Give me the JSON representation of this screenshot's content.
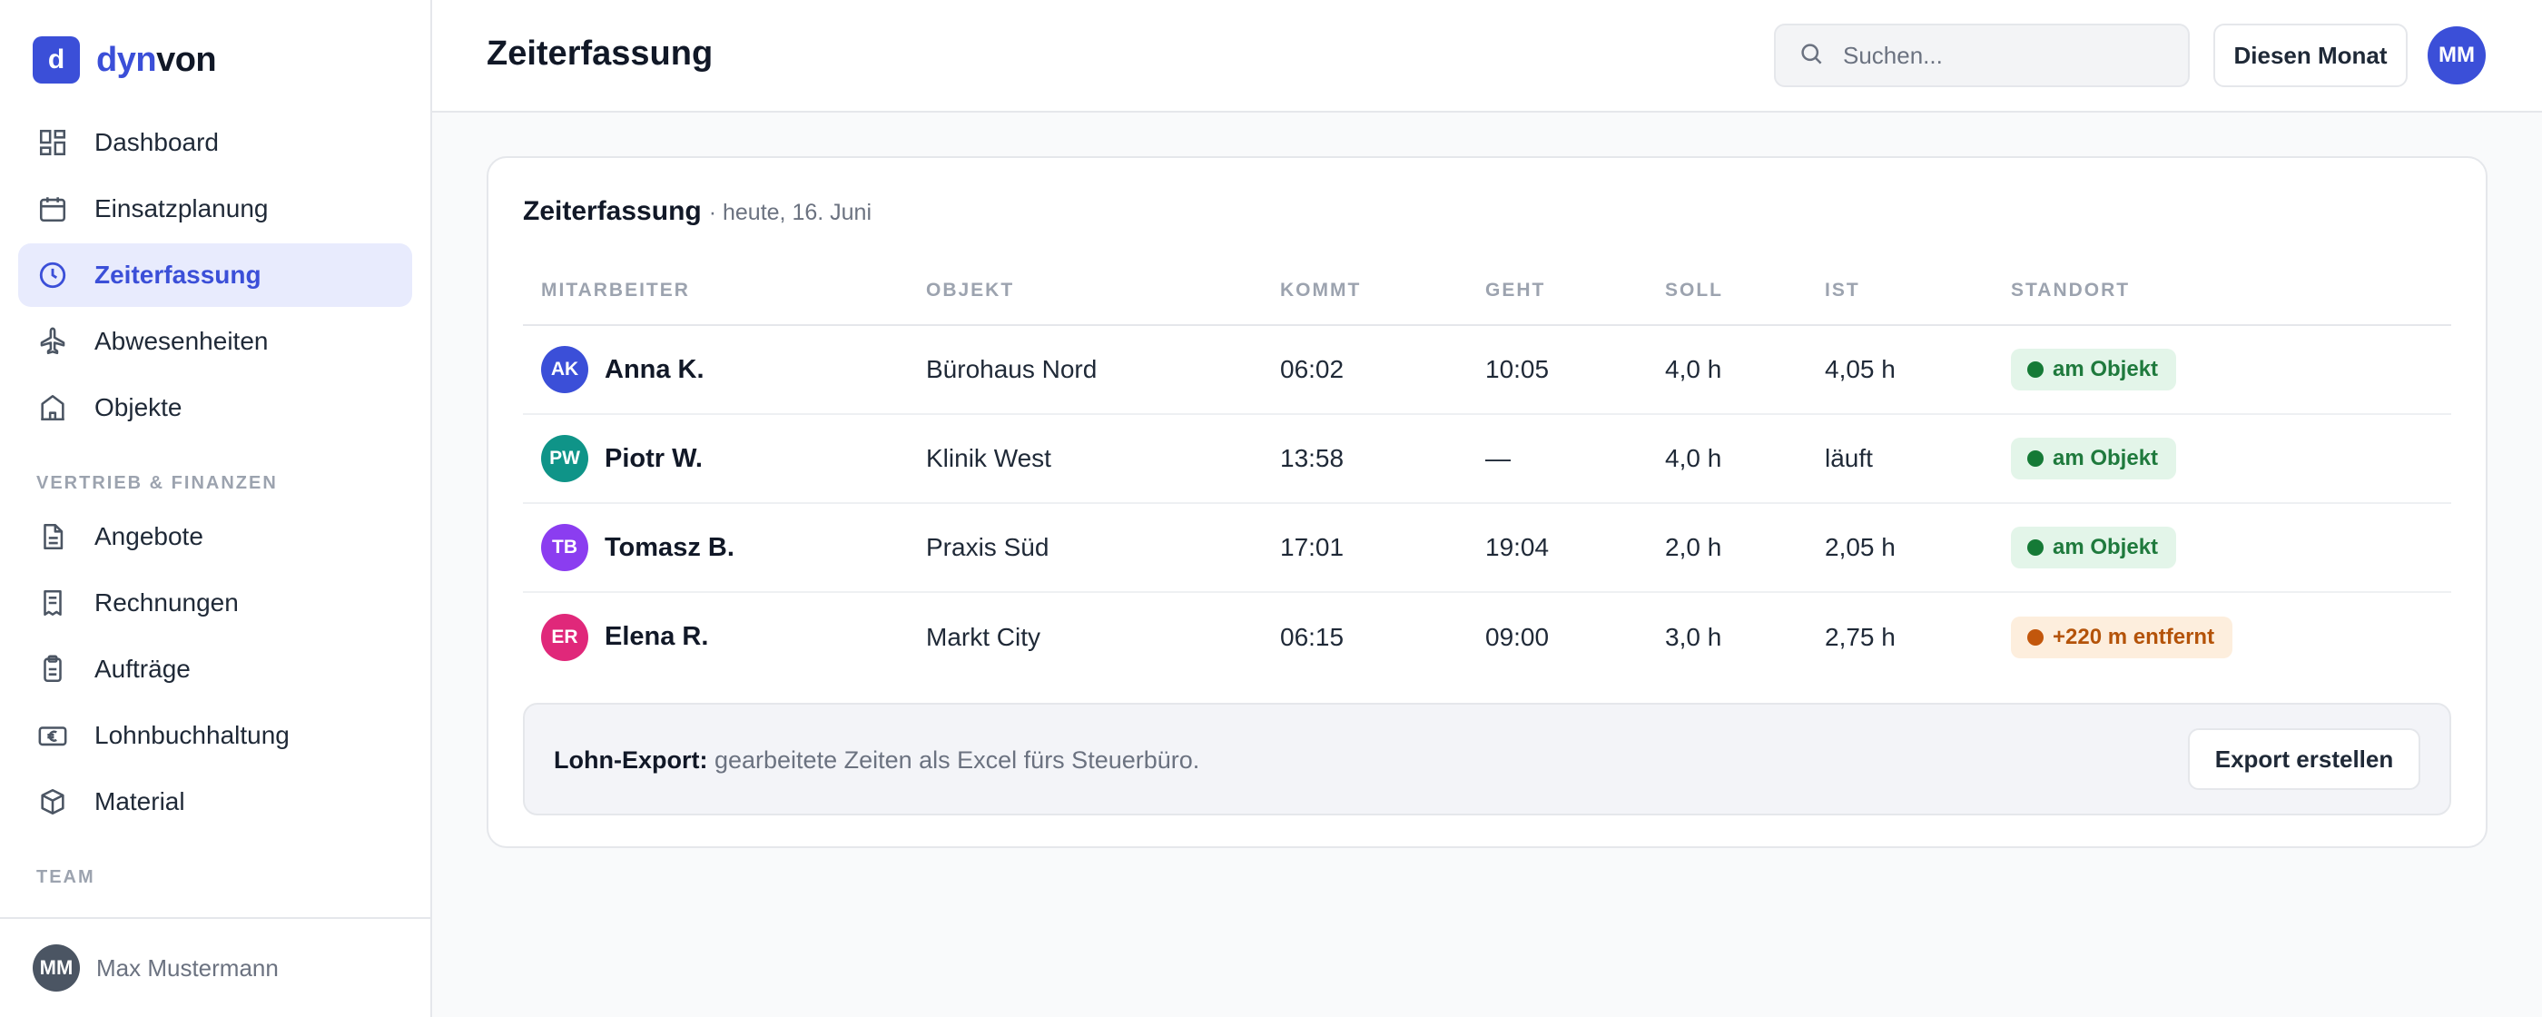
{
  "brand": {
    "mark": "d",
    "name_accent": "dyn",
    "name_rest": "von",
    "color": "#3b4fd8"
  },
  "sidebar": {
    "items": [
      {
        "label": "Dashboard",
        "icon": "dashboard-icon"
      },
      {
        "label": "Einsatzplanung",
        "icon": "calendar-icon"
      },
      {
        "label": "Zeiterfassung",
        "icon": "clock-icon",
        "active": true
      },
      {
        "label": "Abwesenheiten",
        "icon": "plane-icon"
      },
      {
        "label": "Objekte",
        "icon": "building-icon"
      }
    ],
    "section_sales": "VERTRIEB & FINANZEN",
    "sales_items": [
      {
        "label": "Angebote",
        "icon": "document-icon"
      },
      {
        "label": "Rechnungen",
        "icon": "receipt-icon"
      },
      {
        "label": "Aufträge",
        "icon": "clipboard-icon"
      },
      {
        "label": "Lohnbuchhaltung",
        "icon": "euro-icon"
      },
      {
        "label": "Material",
        "icon": "box-icon"
      }
    ],
    "section_team": "TEAM",
    "user": {
      "initials": "MM",
      "name": "Max Mustermann"
    }
  },
  "header": {
    "title": "Zeiterfassung",
    "search_placeholder": "Suchen...",
    "period_button": "Diesen Monat",
    "avatar_initials": "MM"
  },
  "card": {
    "title": "Zeiterfassung",
    "subtitle": "· heute, 16. Juni",
    "columns": [
      "MITARBEITER",
      "OBJEKT",
      "KOMMT",
      "GEHT",
      "SOLL",
      "IST",
      "STANDORT"
    ],
    "rows": [
      {
        "initials": "AK",
        "avatar_color": "#3b4fd8",
        "name": "Anna K.",
        "object": "Bürohaus Nord",
        "in": "06:02",
        "out": "10:05",
        "target": "4,0 h",
        "actual": "4,05 h",
        "location": "am Objekt",
        "status": "ok"
      },
      {
        "initials": "PW",
        "avatar_color": "#0f9488",
        "name": "Piotr W.",
        "object": "Klinik West",
        "in": "13:58",
        "out": "—",
        "target": "4,0 h",
        "actual": "läuft",
        "location": "am Objekt",
        "status": "ok"
      },
      {
        "initials": "TB",
        "avatar_color": "#8b3df0",
        "name": "Tomasz B.",
        "object": "Praxis Süd",
        "in": "17:01",
        "out": "19:04",
        "target": "2,0 h",
        "actual": "2,05 h",
        "location": "am Objekt",
        "status": "ok"
      },
      {
        "initials": "ER",
        "avatar_color": "#e0287a",
        "name": "Elena R.",
        "object": "Markt City",
        "in": "06:15",
        "out": "09:00",
        "target": "3,0 h",
        "actual": "2,75 h",
        "location": "+220 m entfernt",
        "status": "warn"
      }
    ],
    "export": {
      "label": "Lohn-Export:",
      "text": "gearbeitete Zeiten als Excel fürs Steuerbüro.",
      "button": "Export erstellen"
    }
  }
}
